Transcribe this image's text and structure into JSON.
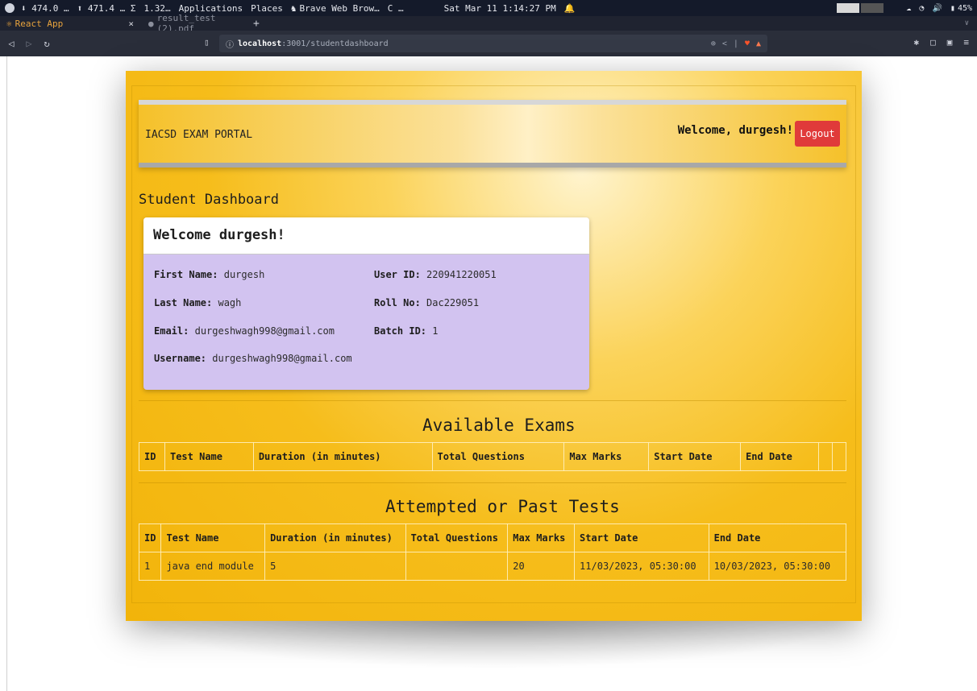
{
  "system_bar": {
    "download": "⬇ 474.0 …",
    "upload": "⬆ 471.4 … Σ",
    "cpu": "1.32…",
    "menu_applications": "Applications",
    "menu_places": "Places",
    "active_app": "Brave Web Brow…",
    "refresh": "C …",
    "clock": "Sat Mar 11  1:14:27 PM",
    "battery": "45%"
  },
  "tabs": [
    {
      "label": "React App",
      "active": true,
      "close": "×"
    },
    {
      "label": "result_test (2).pdf",
      "active": false
    }
  ],
  "newtab": "+",
  "address": {
    "host": "localhost",
    "rest": ":3001/studentdashboard"
  },
  "header": {
    "brand": "IACSD EXAM PORTAL",
    "welcome": "Welcome, durgesh!",
    "logout_label": "Logout"
  },
  "dashboard": {
    "title": "Student Dashboard",
    "card_title": "Welcome durgesh!",
    "fields": {
      "first_name": {
        "label": "First Name:",
        "value": "durgesh"
      },
      "last_name": {
        "label": "Last Name:",
        "value": "wagh"
      },
      "email": {
        "label": "Email:",
        "value": "durgeshwagh998@gmail.com"
      },
      "username": {
        "label": "Username:",
        "value": "durgeshwagh998@gmail.com"
      },
      "user_id": {
        "label": "User ID:",
        "value": "220941220051"
      },
      "roll_no": {
        "label": "Roll No:",
        "value": "Dac229051"
      },
      "batch_id": {
        "label": "Batch ID:",
        "value": "1"
      }
    }
  },
  "available_exams": {
    "title": "Available Exams",
    "columns": [
      "ID",
      "Test Name",
      "Duration (in minutes)",
      "Total Questions",
      "Max Marks",
      "Start Date",
      "End Date"
    ]
  },
  "past_tests": {
    "title": "Attempted or Past Tests",
    "columns": [
      "ID",
      "Test Name",
      "Duration (in minutes)",
      "Total Questions",
      "Max Marks",
      "Start Date",
      "End Date"
    ],
    "rows": [
      {
        "id": "1",
        "name": "java end module",
        "duration": "5",
        "total_questions": "",
        "max_marks": "20",
        "start": "11/03/2023, 05:30:00",
        "end": "10/03/2023, 05:30:00"
      }
    ]
  },
  "colors": {
    "background_gold": "#f6bd1b",
    "card_lavender": "#d2c3f0",
    "logout_red": "#e03a3a"
  }
}
